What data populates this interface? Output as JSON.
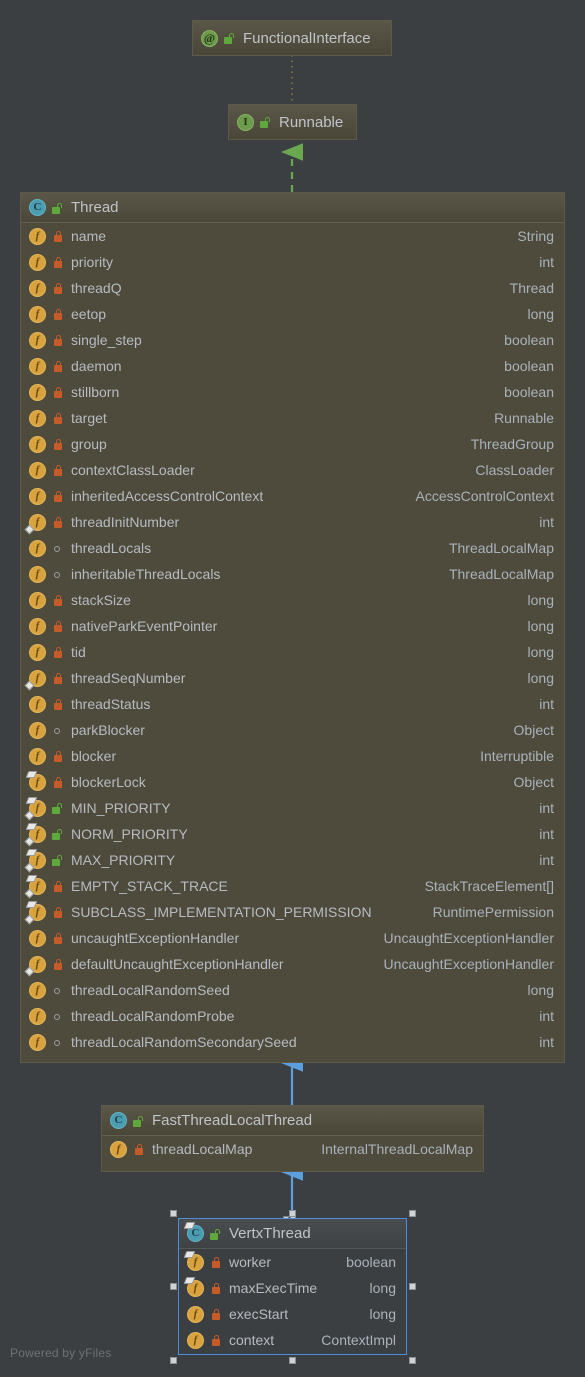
{
  "canvas": {
    "background": "#3c3f41",
    "watermark": "Powered by yFiles",
    "node_fill": "#4e4a3c",
    "selected_fill": "#3c3f41",
    "selection_color": "#4a90d9",
    "implements_edge_color": "#6aa84f",
    "extends_edge_color": "#4a90d9",
    "annotation_edge_color": "#8a8147"
  },
  "nodes": {
    "functional_interface": {
      "title": "FunctionalInterface",
      "kind_icon": "annotation-icon",
      "visibility_icon": "public-unlock-icon",
      "members": []
    },
    "runnable": {
      "title": "Runnable",
      "kind_icon": "interface-icon",
      "visibility_icon": "public-unlock-icon",
      "members": []
    },
    "thread": {
      "title": "Thread",
      "kind_icon": "class-icon",
      "visibility_icon": "public-unlock-icon",
      "members": [
        {
          "name": "name",
          "type": "String",
          "visibility": "private",
          "static": false,
          "final": false
        },
        {
          "name": "priority",
          "type": "int",
          "visibility": "private",
          "static": false,
          "final": false
        },
        {
          "name": "threadQ",
          "type": "Thread",
          "visibility": "private",
          "static": false,
          "final": false
        },
        {
          "name": "eetop",
          "type": "long",
          "visibility": "private",
          "static": false,
          "final": false
        },
        {
          "name": "single_step",
          "type": "boolean",
          "visibility": "private",
          "static": false,
          "final": false
        },
        {
          "name": "daemon",
          "type": "boolean",
          "visibility": "private",
          "static": false,
          "final": false
        },
        {
          "name": "stillborn",
          "type": "boolean",
          "visibility": "private",
          "static": false,
          "final": false
        },
        {
          "name": "target",
          "type": "Runnable",
          "visibility": "private",
          "static": false,
          "final": false
        },
        {
          "name": "group",
          "type": "ThreadGroup",
          "visibility": "private",
          "static": false,
          "final": false
        },
        {
          "name": "contextClassLoader",
          "type": "ClassLoader",
          "visibility": "private",
          "static": false,
          "final": false
        },
        {
          "name": "inheritedAccessControlContext",
          "type": "AccessControlContext",
          "visibility": "private",
          "static": false,
          "final": false
        },
        {
          "name": "threadInitNumber",
          "type": "int",
          "visibility": "private",
          "static": true,
          "final": false
        },
        {
          "name": "threadLocals",
          "type": "ThreadLocalMap",
          "visibility": "package",
          "static": false,
          "final": false
        },
        {
          "name": "inheritableThreadLocals",
          "type": "ThreadLocalMap",
          "visibility": "package",
          "static": false,
          "final": false
        },
        {
          "name": "stackSize",
          "type": "long",
          "visibility": "private",
          "static": false,
          "final": false
        },
        {
          "name": "nativeParkEventPointer",
          "type": "long",
          "visibility": "private",
          "static": false,
          "final": false
        },
        {
          "name": "tid",
          "type": "long",
          "visibility": "private",
          "static": false,
          "final": false
        },
        {
          "name": "threadSeqNumber",
          "type": "long",
          "visibility": "private",
          "static": true,
          "final": false
        },
        {
          "name": "threadStatus",
          "type": "int",
          "visibility": "private",
          "static": false,
          "final": false
        },
        {
          "name": "parkBlocker",
          "type": "Object",
          "visibility": "package",
          "static": false,
          "final": false
        },
        {
          "name": "blocker",
          "type": "Interruptible",
          "visibility": "private",
          "static": false,
          "final": false
        },
        {
          "name": "blockerLock",
          "type": "Object",
          "visibility": "private",
          "static": false,
          "final": true
        },
        {
          "name": "MIN_PRIORITY",
          "type": "int",
          "visibility": "public",
          "static": true,
          "final": true
        },
        {
          "name": "NORM_PRIORITY",
          "type": "int",
          "visibility": "public",
          "static": true,
          "final": true
        },
        {
          "name": "MAX_PRIORITY",
          "type": "int",
          "visibility": "public",
          "static": true,
          "final": true
        },
        {
          "name": "EMPTY_STACK_TRACE",
          "type": "StackTraceElement[]",
          "visibility": "private",
          "static": true,
          "final": true
        },
        {
          "name": "SUBCLASS_IMPLEMENTATION_PERMISSION",
          "type": "RuntimePermission",
          "visibility": "private",
          "static": true,
          "final": true
        },
        {
          "name": "uncaughtExceptionHandler",
          "type": "UncaughtExceptionHandler",
          "visibility": "private",
          "static": false,
          "final": false
        },
        {
          "name": "defaultUncaughtExceptionHandler",
          "type": "UncaughtExceptionHandler",
          "visibility": "private",
          "static": true,
          "final": false
        },
        {
          "name": "threadLocalRandomSeed",
          "type": "long",
          "visibility": "package",
          "static": false,
          "final": false
        },
        {
          "name": "threadLocalRandomProbe",
          "type": "int",
          "visibility": "package",
          "static": false,
          "final": false
        },
        {
          "name": "threadLocalRandomSecondarySeed",
          "type": "int",
          "visibility": "package",
          "static": false,
          "final": false
        }
      ]
    },
    "fast_thread_local_thread": {
      "title": "FastThreadLocalThread",
      "kind_icon": "class-icon",
      "visibility_icon": "public-unlock-icon",
      "members": [
        {
          "name": "threadLocalMap",
          "type": "InternalThreadLocalMap",
          "visibility": "private",
          "static": false,
          "final": false
        }
      ]
    },
    "vertx_thread": {
      "title": "VertxThread",
      "kind_icon": "class-icon",
      "visibility_icon": "public-unlock-icon",
      "selected": true,
      "members": [
        {
          "name": "worker",
          "type": "boolean",
          "visibility": "private",
          "static": false,
          "final": true
        },
        {
          "name": "maxExecTime",
          "type": "long",
          "visibility": "private",
          "static": false,
          "final": true
        },
        {
          "name": "execStart",
          "type": "long",
          "visibility": "private",
          "static": false,
          "final": false
        },
        {
          "name": "context",
          "type": "ContextImpl",
          "visibility": "private",
          "static": false,
          "final": false
        }
      ]
    }
  },
  "edges": [
    {
      "from": "Runnable",
      "to": "FunctionalInterface",
      "style": "dotted",
      "kind": "annotated-by"
    },
    {
      "from": "Thread",
      "to": "Runnable",
      "style": "dashed",
      "kind": "implements"
    },
    {
      "from": "FastThreadLocalThread",
      "to": "Thread",
      "style": "solid",
      "kind": "extends"
    },
    {
      "from": "VertxThread",
      "to": "FastThreadLocalThread",
      "style": "solid",
      "kind": "extends"
    }
  ]
}
